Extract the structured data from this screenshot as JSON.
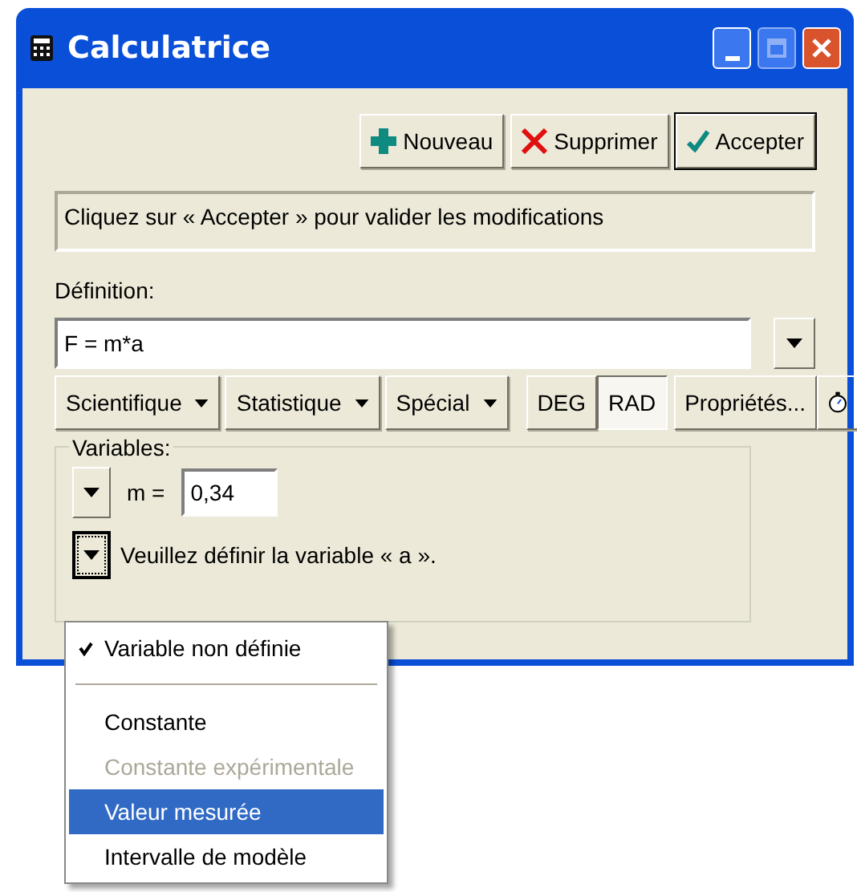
{
  "window": {
    "title": "Calculatrice"
  },
  "toolbar": [
    {
      "kind": "new",
      "label": "Nouveau"
    },
    {
      "kind": "delete",
      "label": "Supprimer"
    },
    {
      "kind": "accept",
      "label": "Accepter"
    }
  ],
  "message": "Cliquez sur « Accepter » pour valider les modifications",
  "definition": {
    "label": "Définition:",
    "value": "F = m*a"
  },
  "function_buttons": [
    {
      "label": "Scientifique"
    },
    {
      "label": "Statistique"
    },
    {
      "label": "Spécial"
    }
  ],
  "angle_modes": [
    {
      "label": "DEG",
      "selected": false
    },
    {
      "label": "RAD",
      "selected": true
    }
  ],
  "properties_button": {
    "label": "Propriétés..."
  },
  "variables": {
    "label": "Variables:",
    "rows": [
      {
        "kind": "value",
        "name": "m =",
        "value": "0,34"
      },
      {
        "kind": "prompt",
        "text": "Veuillez définir la variable « a »."
      }
    ]
  },
  "menu": [
    {
      "kind": "item",
      "label": "Variable non définie",
      "checked": true,
      "disabled": false,
      "selected": false
    },
    {
      "kind": "separator"
    },
    {
      "kind": "item",
      "label": "Constante",
      "checked": false,
      "disabled": false,
      "selected": false
    },
    {
      "kind": "item",
      "label": "Constante expérimentale",
      "checked": false,
      "disabled": true,
      "selected": false
    },
    {
      "kind": "item",
      "label": "Valeur mesurée",
      "checked": false,
      "disabled": false,
      "selected": true
    },
    {
      "kind": "item",
      "label": "Intervalle de modèle",
      "checked": false,
      "disabled": false,
      "selected": false
    }
  ]
}
